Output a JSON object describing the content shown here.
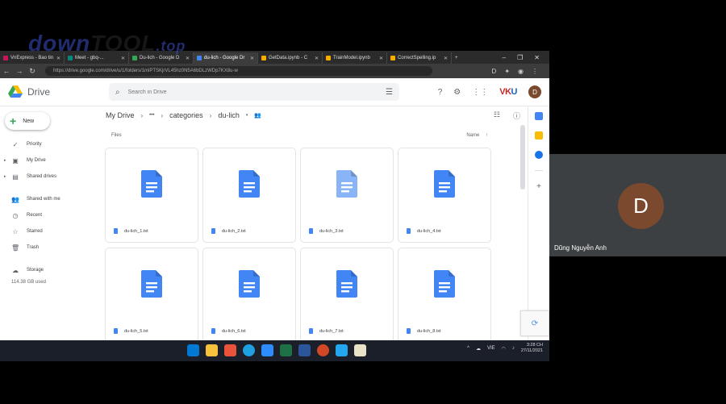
{
  "browser": {
    "tabs": [
      {
        "label": "VnExpress - Bao tin",
        "color": "#c2185b",
        "active": false
      },
      {
        "label": "Meet - gbq-...",
        "color": "#00897b",
        "active": false
      },
      {
        "label": "Du-lich - Google D",
        "color": "#34a853",
        "active": false
      },
      {
        "label": "du-lich - Google Dr",
        "color": "#4285f4",
        "active": true
      },
      {
        "label": "GetData.ipynb - C",
        "color": "#f9ab00",
        "active": false
      },
      {
        "label": "TrainModel.ipynb",
        "color": "#f9ab00",
        "active": false
      },
      {
        "label": "CorrectSpelling.ip",
        "color": "#f9ab00",
        "active": false
      }
    ],
    "new_tab": "+",
    "window_controls": {
      "min": "–",
      "max": "❐",
      "close": "✕"
    },
    "url": "https://drive.google.com/drive/u/1/folders/1miPTSKjrVL45hz0N5A6bDLzWDp7KX8u-w"
  },
  "drive": {
    "app_name": "Drive",
    "search_placeholder": "Search in Drive",
    "org_logo": {
      "a": "VK",
      "b": "U"
    },
    "avatar_letter": "D",
    "new_label": "New",
    "sidebar": [
      {
        "label": "Priority",
        "icon": "✓",
        "caret": false
      },
      {
        "label": "My Drive",
        "icon": "▣",
        "caret": true
      },
      {
        "label": "Shared drives",
        "icon": "▤",
        "caret": true
      },
      {
        "label": "Shared with me",
        "icon": "👥",
        "caret": false
      },
      {
        "label": "Recent",
        "icon": "◷",
        "caret": false
      },
      {
        "label": "Starred",
        "icon": "☆",
        "caret": false
      },
      {
        "label": "Trash",
        "icon": "🗑",
        "caret": false
      }
    ],
    "storage": {
      "label": "Storage",
      "used": "114.38 GB used"
    },
    "breadcrumb": {
      "root": "My Drive",
      "ellipsis": "•••",
      "parent": "categories",
      "current": "du-lich"
    },
    "files_label": "Files",
    "sort_label": "Name",
    "files": [
      {
        "name": "du-lich_1.txt",
        "light": false
      },
      {
        "name": "du-lich_2.txt",
        "light": false
      },
      {
        "name": "du-lich_3.txt",
        "light": true
      },
      {
        "name": "du-lich_4.txt",
        "light": false
      },
      {
        "name": "du-lich_5.txt",
        "light": false
      },
      {
        "name": "du-lich_6.txt",
        "light": false
      },
      {
        "name": "du-lich_7.txt",
        "light": false
      },
      {
        "name": "du-lich_8.txt",
        "light": false
      }
    ]
  },
  "taskbar": {
    "lang": "VIE",
    "time": "3:28 CH",
    "date": "27/11/2021"
  },
  "meeting": {
    "participant_letter": "D",
    "participant_name": "Dũng Nguyễn Anh"
  },
  "watermark": {
    "part1": "down",
    "part2": "TOOL",
    "part3": ".top"
  },
  "colors": {
    "doc_blue": "#4285f4",
    "doc_light": "#8ab4f8",
    "avatar": "#7b4a2e"
  }
}
